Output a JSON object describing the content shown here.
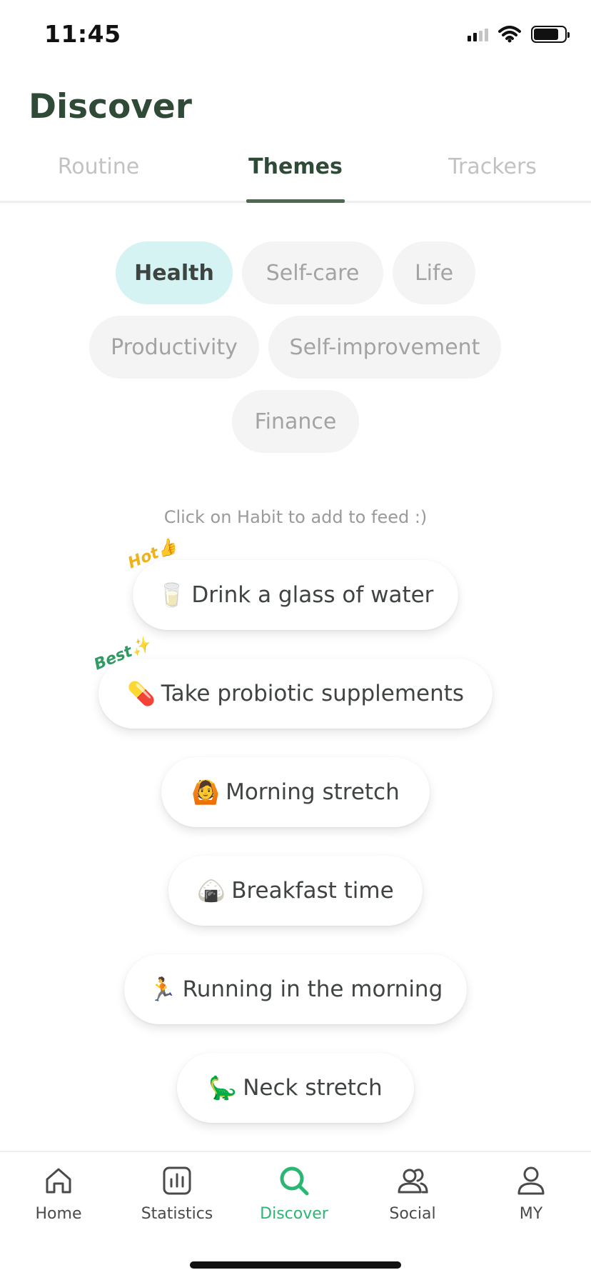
{
  "status_bar": {
    "time": "11:45"
  },
  "header": {
    "title": "Discover"
  },
  "tabs": [
    {
      "label": "Routine"
    },
    {
      "label": "Themes"
    },
    {
      "label": "Trackers"
    }
  ],
  "active_tab": "Themes",
  "categories": [
    {
      "label": "Health"
    },
    {
      "label": "Self-care"
    },
    {
      "label": "Life"
    },
    {
      "label": "Productivity"
    },
    {
      "label": "Self-improvement"
    },
    {
      "label": "Finance"
    }
  ],
  "active_category": "Health",
  "hint": "Click on Habit to add to feed :)",
  "badges": {
    "hot": "Hot👍",
    "best": "Best✨"
  },
  "habits": [
    {
      "emoji": "🥛",
      "label": "Drink a glass of water"
    },
    {
      "emoji": "💊",
      "label": "Take probiotic supplements"
    },
    {
      "emoji": "🙆",
      "label": "Morning stretch"
    },
    {
      "emoji": "🍙",
      "label": "Breakfast time"
    },
    {
      "emoji": "🏃",
      "label": "Running in the morning"
    },
    {
      "emoji": "🦕",
      "label": "Neck stretch"
    }
  ],
  "bottom_nav": [
    {
      "label": "Home",
      "icon": "home-icon"
    },
    {
      "label": "Statistics",
      "icon": "statistics-icon"
    },
    {
      "label": "Discover",
      "icon": "search-icon"
    },
    {
      "label": "Social",
      "icon": "social-icon"
    },
    {
      "label": "MY",
      "icon": "person-icon"
    }
  ],
  "active_nav": "Discover",
  "colors": {
    "accent": "#2bb673",
    "title": "#2f4a36",
    "active_chip": "#d6f3f3",
    "tab_indicator": "#4d6a50"
  }
}
